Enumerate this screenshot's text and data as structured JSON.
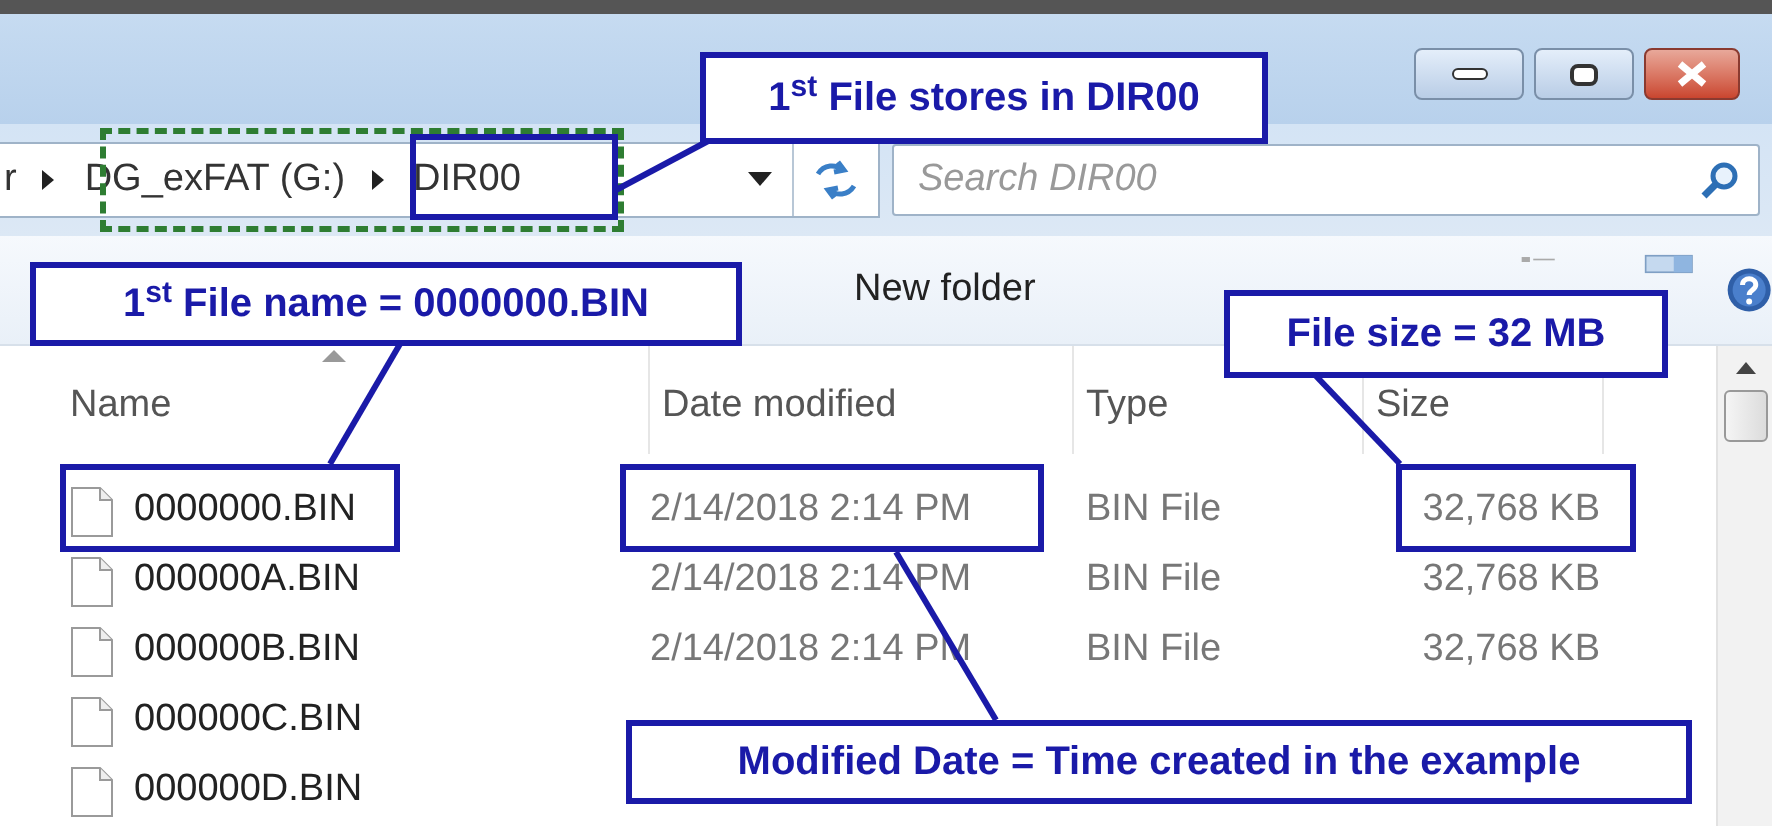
{
  "address_bar": {
    "crumbs": [
      "r",
      "DG_exFAT (G:)",
      "DIR00"
    ]
  },
  "search": {
    "placeholder": "Search DIR00"
  },
  "toolbar": {
    "new_folder": "New folder"
  },
  "table": {
    "columns": [
      {
        "label": "Name",
        "sorted": true
      },
      {
        "label": "Date modified",
        "sorted": false
      },
      {
        "label": "Type",
        "sorted": false
      },
      {
        "label": "Size",
        "sorted": false
      }
    ],
    "rows": [
      {
        "name": "0000000.BIN",
        "date": "2/14/2018 2:14 PM",
        "type": "BIN File",
        "size": "32,768 KB"
      },
      {
        "name": "000000A.BIN",
        "date": "2/14/2018 2:14 PM",
        "type": "BIN File",
        "size": "32,768 KB"
      },
      {
        "name": "000000B.BIN",
        "date": "2/14/2018 2:14 PM",
        "type": "BIN File",
        "size": "32,768 KB"
      },
      {
        "name": "000000C.BIN"
      },
      {
        "name": "000000D.BIN"
      }
    ]
  },
  "callouts": [
    {
      "text": "1$^{st}$ File stores in DIR00"
    },
    {
      "text": "1$^{st}$ File name = 0000000.BIN"
    },
    {
      "text": "File size = 32 MB"
    },
    {
      "text": "Modified Date = Time created in the example"
    }
  ]
}
